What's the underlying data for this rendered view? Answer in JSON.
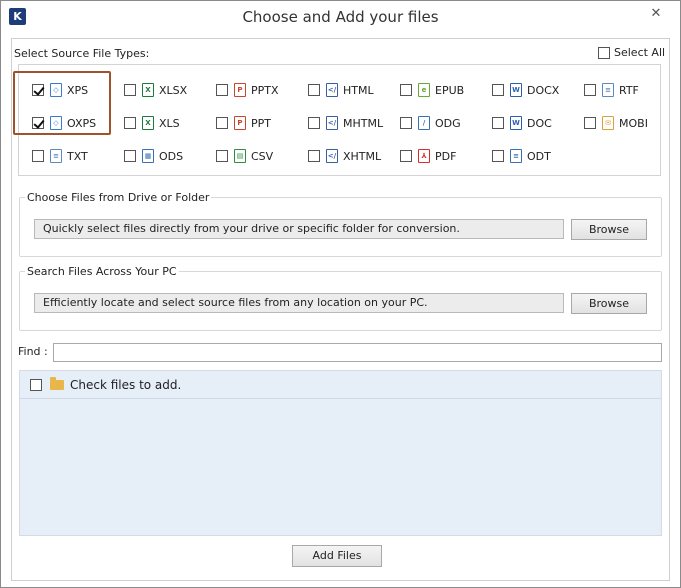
{
  "window": {
    "title": "Choose and Add your files",
    "app_icon_letter": "K",
    "close_glyph": "✕"
  },
  "file_types": {
    "label": "Select Source File Types:",
    "select_all_label": "Select All",
    "select_all_checked": false,
    "items": [
      {
        "label": "XPS",
        "checked": true,
        "icon": "xps-file-icon",
        "color": "#3a7cc7"
      },
      {
        "label": "OXPS",
        "checked": true,
        "icon": "oxps-file-icon",
        "color": "#3a7cc7"
      },
      {
        "label": "TXT",
        "checked": false,
        "icon": "txt-file-icon",
        "color": "#5a8ac0"
      },
      {
        "label": "XLSX",
        "checked": false,
        "icon": "xlsx-file-icon",
        "color": "#1e7a3c"
      },
      {
        "label": "XLS",
        "checked": false,
        "icon": "xls-file-icon",
        "color": "#1e7a3c"
      },
      {
        "label": "ODS",
        "checked": false,
        "icon": "ods-file-icon",
        "color": "#3a6fb5"
      },
      {
        "label": "PPTX",
        "checked": false,
        "icon": "pptx-file-icon",
        "color": "#c8462b"
      },
      {
        "label": "PPT",
        "checked": false,
        "icon": "ppt-file-icon",
        "color": "#c8462b"
      },
      {
        "label": "CSV",
        "checked": false,
        "icon": "csv-file-icon",
        "color": "#2e8b3e"
      },
      {
        "label": "HTML",
        "checked": false,
        "icon": "html-file-icon",
        "color": "#3a5fa0"
      },
      {
        "label": "MHTML",
        "checked": false,
        "icon": "mhtml-file-icon",
        "color": "#3a5fa0"
      },
      {
        "label": "XHTML",
        "checked": false,
        "icon": "xhtml-file-icon",
        "color": "#3a5fa0"
      },
      {
        "label": "EPUB",
        "checked": false,
        "icon": "epub-file-icon",
        "color": "#6aa83a"
      },
      {
        "label": "ODG",
        "checked": false,
        "icon": "odg-file-icon",
        "color": "#3a6fb5"
      },
      {
        "label": "PDF",
        "checked": false,
        "icon": "pdf-file-icon",
        "color": "#d0302a"
      },
      {
        "label": "DOCX",
        "checked": false,
        "icon": "docx-file-icon",
        "color": "#2b5fb0"
      },
      {
        "label": "DOC",
        "checked": false,
        "icon": "doc-file-icon",
        "color": "#2b5fb0"
      },
      {
        "label": "ODT",
        "checked": false,
        "icon": "odt-file-icon",
        "color": "#3a6fb5"
      },
      {
        "label": "RTF",
        "checked": false,
        "icon": "rtf-file-icon",
        "color": "#5a8ac0"
      },
      {
        "label": "MOBI",
        "checked": false,
        "icon": "mobi-file-icon",
        "color": "#d8a33a"
      }
    ]
  },
  "drive_group": {
    "title": "Choose Files from Drive or Folder",
    "description": "Quickly select files directly from your drive or specific folder for conversion.",
    "browse_label": "Browse"
  },
  "search_group": {
    "title": "Search Files Across Your PC",
    "description": "Efficiently locate and select source files from any location on your PC.",
    "browse_label": "Browse"
  },
  "find": {
    "label": "Find :",
    "value": ""
  },
  "files_list": {
    "header_label": "Check files to add.",
    "checked": false
  },
  "add_files_label": "Add Files"
}
